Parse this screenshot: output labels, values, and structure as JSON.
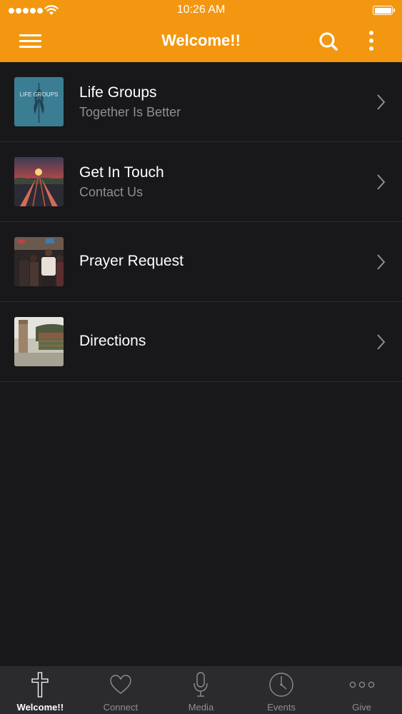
{
  "status_bar": {
    "time": "10:26 AM"
  },
  "nav": {
    "title": "Welcome!!",
    "menu_icon": "hamburger-menu-icon",
    "search_icon": "search-icon",
    "more_icon": "more-vertical-icon"
  },
  "colors": {
    "accent": "#f39710",
    "background": "#18181b",
    "tab_bar": "#2b2b2e",
    "subtitle": "#8e8e93"
  },
  "list": {
    "items": [
      {
        "title": "Life Groups",
        "subtitle": "Together Is Better",
        "thumb_text": "LIFE GROUPS",
        "icon": "chevron-right-icon"
      },
      {
        "title": "Get In Touch",
        "subtitle": "Contact Us",
        "icon": "chevron-right-icon"
      },
      {
        "title": "Prayer Request",
        "icon": "chevron-right-icon"
      },
      {
        "title": "Directions",
        "icon": "chevron-right-icon"
      }
    ]
  },
  "tabs": [
    {
      "label": "Welcome!!",
      "icon": "cross-icon",
      "active": true
    },
    {
      "label": "Connect",
      "icon": "heart-icon",
      "active": false
    },
    {
      "label": "Media",
      "icon": "microphone-icon",
      "active": false
    },
    {
      "label": "Events",
      "icon": "clock-icon",
      "active": false
    },
    {
      "label": "Give",
      "icon": "more-horizontal-icon",
      "active": false
    }
  ]
}
